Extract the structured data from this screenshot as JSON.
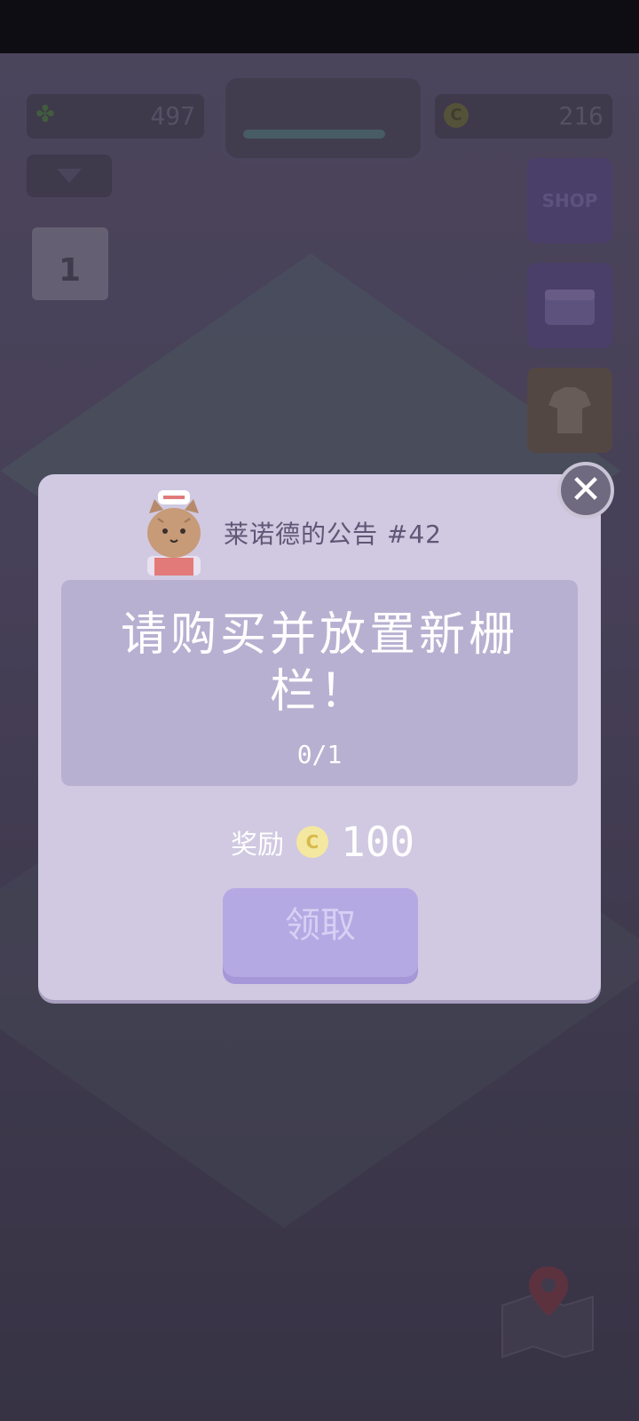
{
  "hud": {
    "clover_count": "497",
    "coin_count": "216",
    "shop_label": "SHOP",
    "calendar_day": "1"
  },
  "colors": {
    "dialog_bg": "#d0c9e1",
    "panel_bg": "#b8b0d1",
    "button_bg": "#b5a9e3",
    "coin": "#f4e7a0"
  },
  "dialog": {
    "title": "莱诺德的公告 #42",
    "task_text": "请购买并放置新栅栏！",
    "progress": "0/1",
    "reward_label": "奖励",
    "reward_coin_symbol": "C",
    "reward_amount": "100",
    "claim_label": "领取",
    "close_symbol": "✕"
  },
  "icons": {
    "close": "close-icon",
    "cat": "cat-avatar-icon",
    "coin": "coin-icon",
    "map": "map-pin-icon"
  }
}
